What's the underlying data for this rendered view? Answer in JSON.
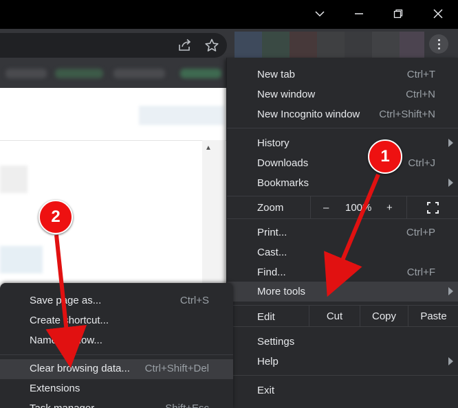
{
  "window_controls": {
    "tab_search_icon": "chevron-down-icon",
    "minimize_icon": "minimize-icon",
    "restore_icon": "restore-icon",
    "close_icon": "close-icon"
  },
  "toolbar": {
    "share_icon": "share-icon",
    "bookmark_icon": "star-icon",
    "menu_icon": "kebab-menu-icon"
  },
  "menu": {
    "new_tab": {
      "label": "New tab",
      "shortcut": "Ctrl+T"
    },
    "new_window": {
      "label": "New window",
      "shortcut": "Ctrl+N"
    },
    "incognito": {
      "label": "New Incognito window",
      "shortcut": "Ctrl+Shift+N"
    },
    "history": {
      "label": "History"
    },
    "downloads": {
      "label": "Downloads",
      "shortcut": "Ctrl+J"
    },
    "bookmarks": {
      "label": "Bookmarks"
    },
    "zoom": {
      "label": "Zoom",
      "minus": "–",
      "value": "100%",
      "plus": "+",
      "fullscreen_icon": "fullscreen-icon"
    },
    "print": {
      "label": "Print...",
      "shortcut": "Ctrl+P"
    },
    "cast": {
      "label": "Cast..."
    },
    "find": {
      "label": "Find...",
      "shortcut": "Ctrl+F"
    },
    "more_tools": {
      "label": "More tools"
    },
    "edit": {
      "label": "Edit",
      "cut": "Cut",
      "copy": "Copy",
      "paste": "Paste"
    },
    "settings": {
      "label": "Settings"
    },
    "help": {
      "label": "Help"
    },
    "exit": {
      "label": "Exit"
    }
  },
  "submenu": {
    "save_page": {
      "label": "Save page as...",
      "shortcut": "Ctrl+S"
    },
    "create_shortcut": {
      "label": "Create shortcut..."
    },
    "name_window": {
      "label": "Name window..."
    },
    "clear_browsing": {
      "label": "Clear browsing data...",
      "shortcut": "Ctrl+Shift+Del"
    },
    "extensions": {
      "label": "Extensions"
    },
    "task_manager": {
      "label": "Task manager",
      "shortcut": "Shift+Esc"
    }
  },
  "annotations": {
    "callout_1": "1",
    "callout_2": "2",
    "arrow_color": "#e11111"
  }
}
